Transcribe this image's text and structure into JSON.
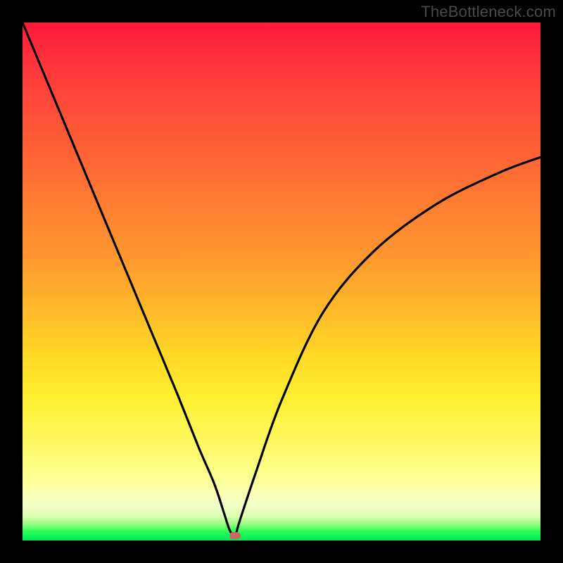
{
  "watermark": "TheBottleneck.com",
  "colors": {
    "frame_border": "#000000",
    "curve": "#000000",
    "marker": "#c96a5e",
    "gradient_top": "#ff1a3a",
    "gradient_bottom": "#00e85e"
  },
  "chart_data": {
    "type": "line",
    "title": "",
    "xlabel": "",
    "ylabel": "",
    "xlim": [
      0,
      100
    ],
    "ylim": [
      0,
      100
    ],
    "annotations": [
      {
        "name": "minimum-marker",
        "x": 41,
        "y": 1
      }
    ],
    "series": [
      {
        "name": "bottleneck-curve",
        "x": [
          0,
          5,
          10,
          15,
          20,
          25,
          30,
          34,
          37,
          39,
          40,
          41,
          42,
          45,
          50,
          58,
          68,
          80,
          92,
          100
        ],
        "y": [
          100,
          88,
          76,
          64,
          52,
          40,
          28,
          18,
          11,
          5,
          2,
          1,
          4,
          13,
          27,
          44,
          56,
          65,
          71,
          74
        ]
      }
    ],
    "background_gradient": {
      "type": "vertical",
      "stops": [
        {
          "pos": 0,
          "meaning": "worst",
          "color": "#ff1a3a"
        },
        {
          "pos": 0.5,
          "meaning": "mid",
          "color": "#ffbb2a"
        },
        {
          "pos": 0.88,
          "meaning": "good",
          "color": "#fdff94"
        },
        {
          "pos": 1.0,
          "meaning": "best",
          "color": "#00e85e"
        }
      ]
    }
  }
}
